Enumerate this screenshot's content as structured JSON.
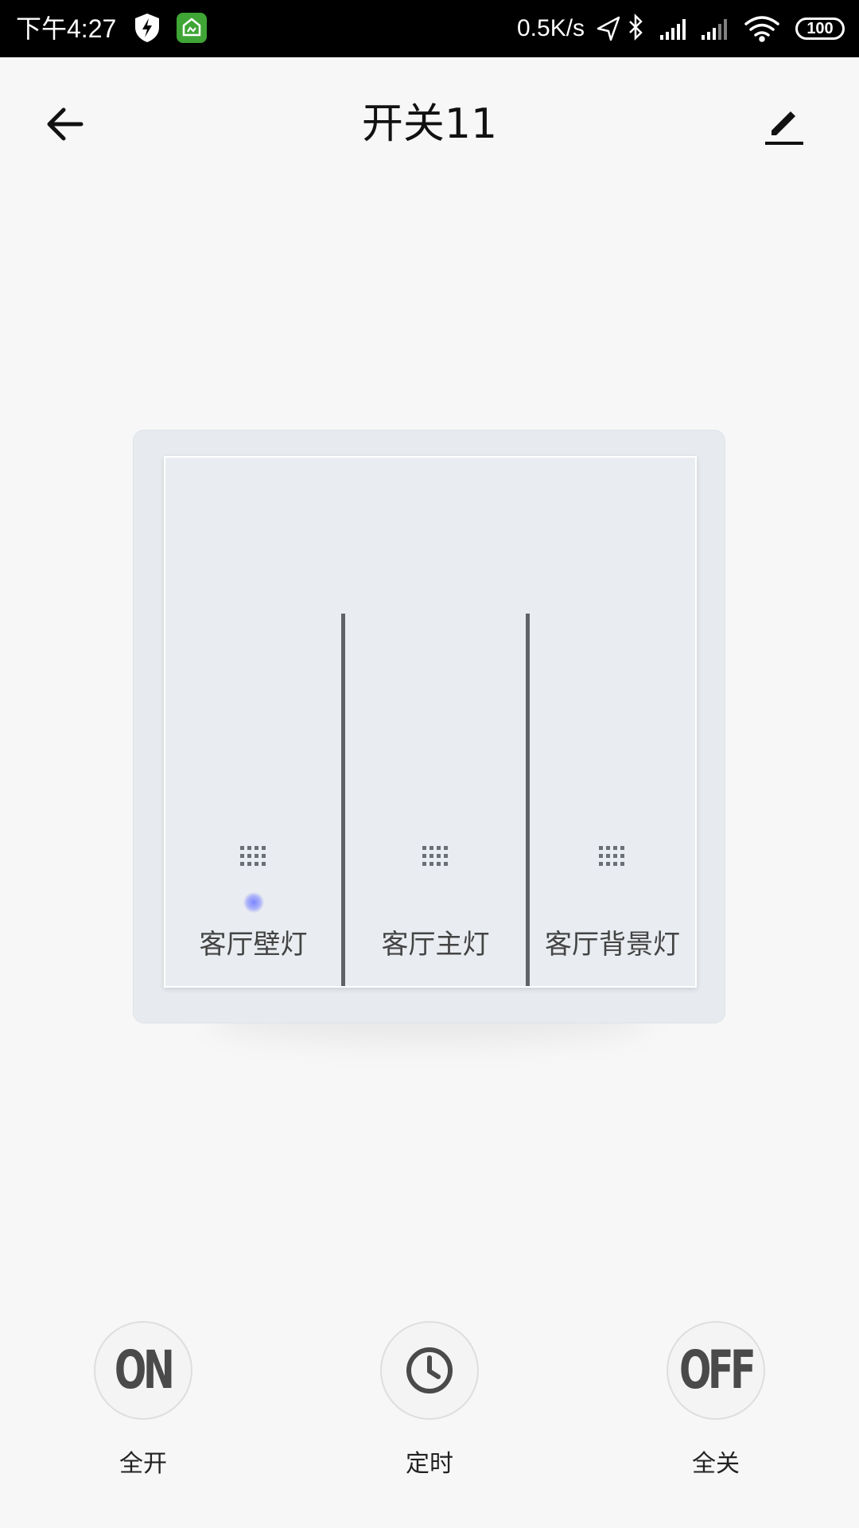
{
  "status_bar": {
    "time": "下午4:27",
    "net_speed": "0.5K/s",
    "battery": "100"
  },
  "header": {
    "title": "开关11"
  },
  "switch_panel": {
    "gangs": [
      {
        "label": "客厅壁灯",
        "indicator_on": true
      },
      {
        "label": "客厅主灯",
        "indicator_on": false
      },
      {
        "label": "客厅背景灯",
        "indicator_on": false
      }
    ]
  },
  "controls": {
    "all_on": {
      "icon_text": "ON",
      "label": "全开"
    },
    "timer": {
      "icon": "clock-icon",
      "label": "定时"
    },
    "all_off": {
      "icon_text": "OFF",
      "label": "全关"
    }
  },
  "colors": {
    "indicator": "#7b86ff",
    "status_bar_bg": "#000000",
    "page_bg": "#f7f7f7"
  }
}
